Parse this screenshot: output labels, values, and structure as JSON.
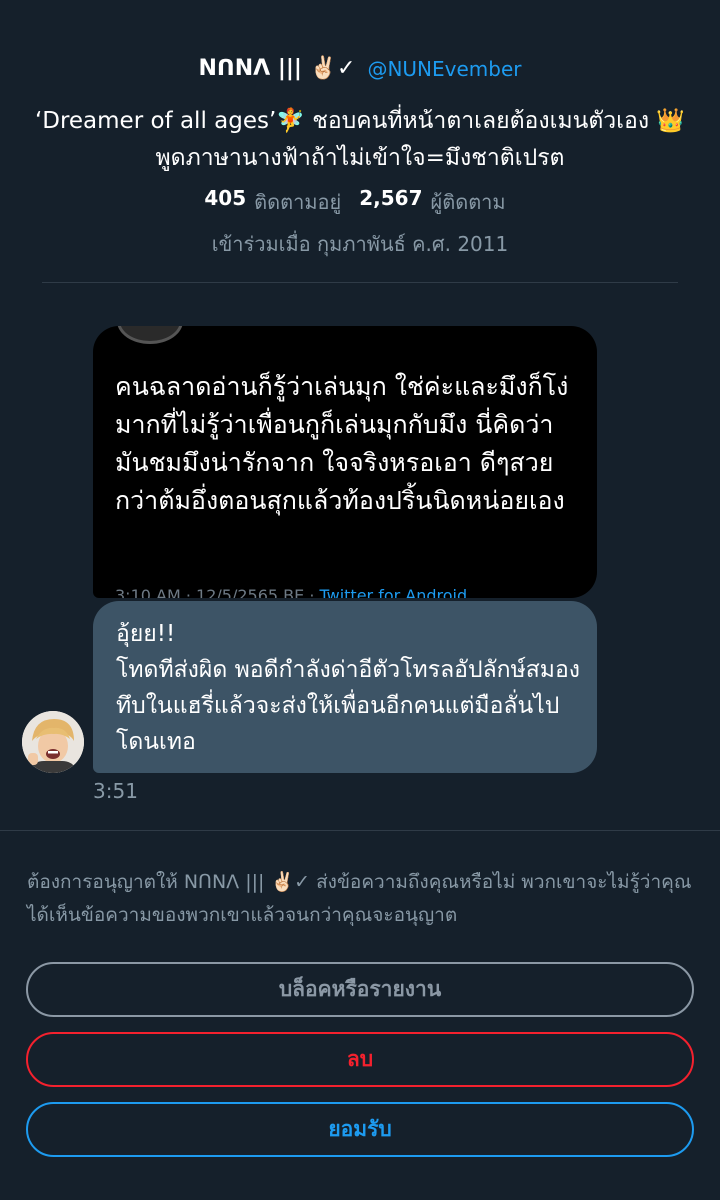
{
  "profile": {
    "display_name": "NꓵNΛ ||| ✌🏻✓",
    "handle": "@NUNEvember",
    "bio": "‘Dreamer of all ages’🧚 ชอบคนที่หน้าตาเลยต้องเมนตัวเอง 👑 พูดภาษานางฟ้าถ้าไม่เข้าใจ=มึงชาติเปรต",
    "following_count": "405",
    "following_label": "ติดตามอยู่",
    "followers_count": "2,567",
    "followers_label": "ผู้ติดตาม",
    "joined": "เข้าร่วมเมื่อ กุมภาพันธ์ ค.ศ. 2011"
  },
  "messages": [
    {
      "type": "image",
      "image_text": "คนฉลาดอ่านก็รู้ว่าเล่นมุก ใช่ค่ะและมึงก็โง่มากที่ไม่รู้ว่าเพื่อนกูก็เล่นมุกกับมึง นี่คิดว่ามันชมมึงน่ารักจาก ใจจริงหรอเอา ดีๆสวยกว่าต้มอึ่งตอนสุกแล้วท้องปริ้นนิดหน่อยเอง",
      "image_footer_time": "3:10 AM · 12/5/2565 BE · ",
      "image_footer_source": "Twitter for Android"
    },
    {
      "type": "text",
      "text": "อุ้ยย!!\nโทดทีส่งผิด พอดีกำลังด่าอีตัวโทรลอัปลักษ์สมองทึบในแฮรี่แล้วจะส่งให้เพื่อนอีกคนแต่มือลั่นไปโดนเทอ",
      "time": "3:51"
    }
  ],
  "request": {
    "text": "ต้องการอนุญาตให้ NꓵNΛ ||| ✌🏻✓ ส่งข้อความถึงคุณหรือไม่ พวกเขาจะไม่รู้ว่าคุณได้เห็นข้อความของพวกเขาแล้วจนกว่าคุณจะอนุญาต",
    "block_label": "บล็อคหรือรายงาน",
    "delete_label": "ลบ",
    "accept_label": "ยอมรับ"
  },
  "colors": {
    "background": "#15202b",
    "accent_blue": "#1d9bf0",
    "danger_red": "#f4212e",
    "bubble": "#3d5466",
    "muted": "#8899a6"
  }
}
